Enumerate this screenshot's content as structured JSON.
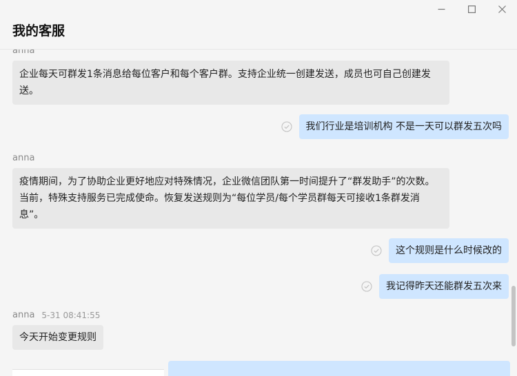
{
  "header": {
    "title": "我的客服"
  },
  "window_controls": {
    "minimize": "minimize-icon",
    "maximize": "maximize-icon",
    "close": "close-icon"
  },
  "messages": [
    {
      "sender": "anna",
      "direction": "in",
      "text": "企业每天可群发1条消息给每位客户和每个客户群。支持企业统一创建发送，成员也可自己创建发送。"
    },
    {
      "direction": "out",
      "text": "我们行业是培训机构 不是一天可以群发五次吗",
      "status": "read-check-icon"
    },
    {
      "sender": "anna",
      "direction": "in",
      "text": "疫情期间，为了协助企业更好地应对特殊情况，企业微信团队第一时间提升了“群发助手”的次数。当前，特殊支持服务已完成使命。恢复发送规则为“每位学员/每个学员群每天可接收1条群发消息”。"
    },
    {
      "direction": "out",
      "text": "这个规则是什么时候改的",
      "status": "read-check-icon"
    },
    {
      "direction": "out",
      "text": "我记得昨天还能群发五次来",
      "status": "read-check-icon"
    },
    {
      "sender": "anna",
      "time": "5-31 08:41:55",
      "direction": "in",
      "text": "今天开始变更规则"
    }
  ],
  "colors": {
    "incoming_bubble": "#e8e8e8",
    "outgoing_bubble": "#cfe6ff",
    "background": "#f5f5f5"
  }
}
